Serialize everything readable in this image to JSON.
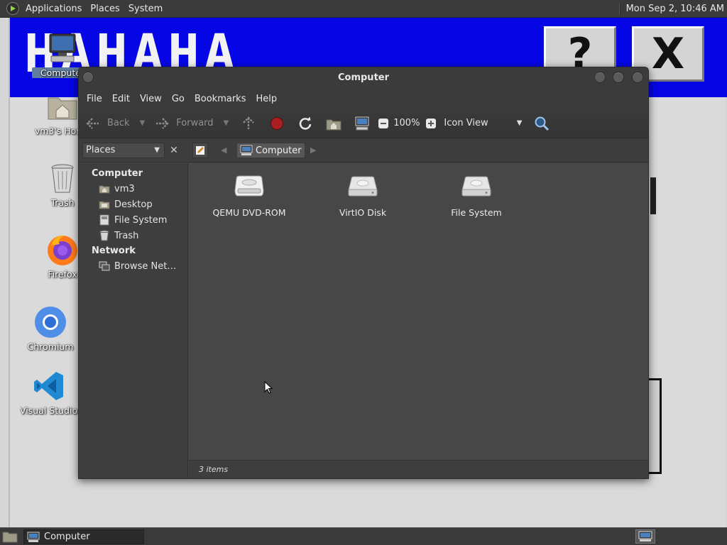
{
  "top_panel": {
    "menus": [
      "Applications",
      "Places",
      "System"
    ],
    "clock": "Mon Sep  2, 10:46 AM"
  },
  "background_app": {
    "banner_text": "HAHAHA",
    "help_button": "?",
    "close_button": "X",
    "banner_color": "#0505e6"
  },
  "desktop": {
    "icons": [
      {
        "label": "Computer",
        "icon": "computer-icon"
      },
      {
        "label": "vm3's Home",
        "icon": "home-folder-icon"
      },
      {
        "label": "Trash",
        "icon": "trash-icon"
      },
      {
        "label": "Firefox",
        "icon": "firefox-icon"
      },
      {
        "label": "Chromium",
        "icon": "chromium-icon"
      },
      {
        "label": "Visual Studio Code",
        "icon": "vscode-icon"
      }
    ]
  },
  "file_manager": {
    "title": "Computer",
    "menu": [
      "File",
      "Edit",
      "View",
      "Go",
      "Bookmarks",
      "Help"
    ],
    "toolbar": {
      "back": "Back",
      "forward": "Forward",
      "zoom": "100%",
      "view_mode": "Icon View"
    },
    "places_select": "Places",
    "breadcrumb": "Computer",
    "sidebar": {
      "computer_header": "Computer",
      "computer_items": [
        {
          "label": "vm3",
          "icon": "home-folder-icon"
        },
        {
          "label": "Desktop",
          "icon": "desktop-icon"
        },
        {
          "label": "File System",
          "icon": "filesystem-icon"
        },
        {
          "label": "Trash",
          "icon": "trash-icon"
        }
      ],
      "network_header": "Network",
      "network_items": [
        {
          "label": "Browse Net…",
          "icon": "network-icon"
        }
      ]
    },
    "items": [
      {
        "label": "QEMU DVD-ROM",
        "icon": "optical-drive-icon"
      },
      {
        "label": "VirtIO Disk",
        "icon": "hard-disk-icon"
      },
      {
        "label": "File System",
        "icon": "hard-disk-icon"
      }
    ],
    "status": "3 items"
  },
  "taskbar": {
    "task_label": "Computer"
  }
}
